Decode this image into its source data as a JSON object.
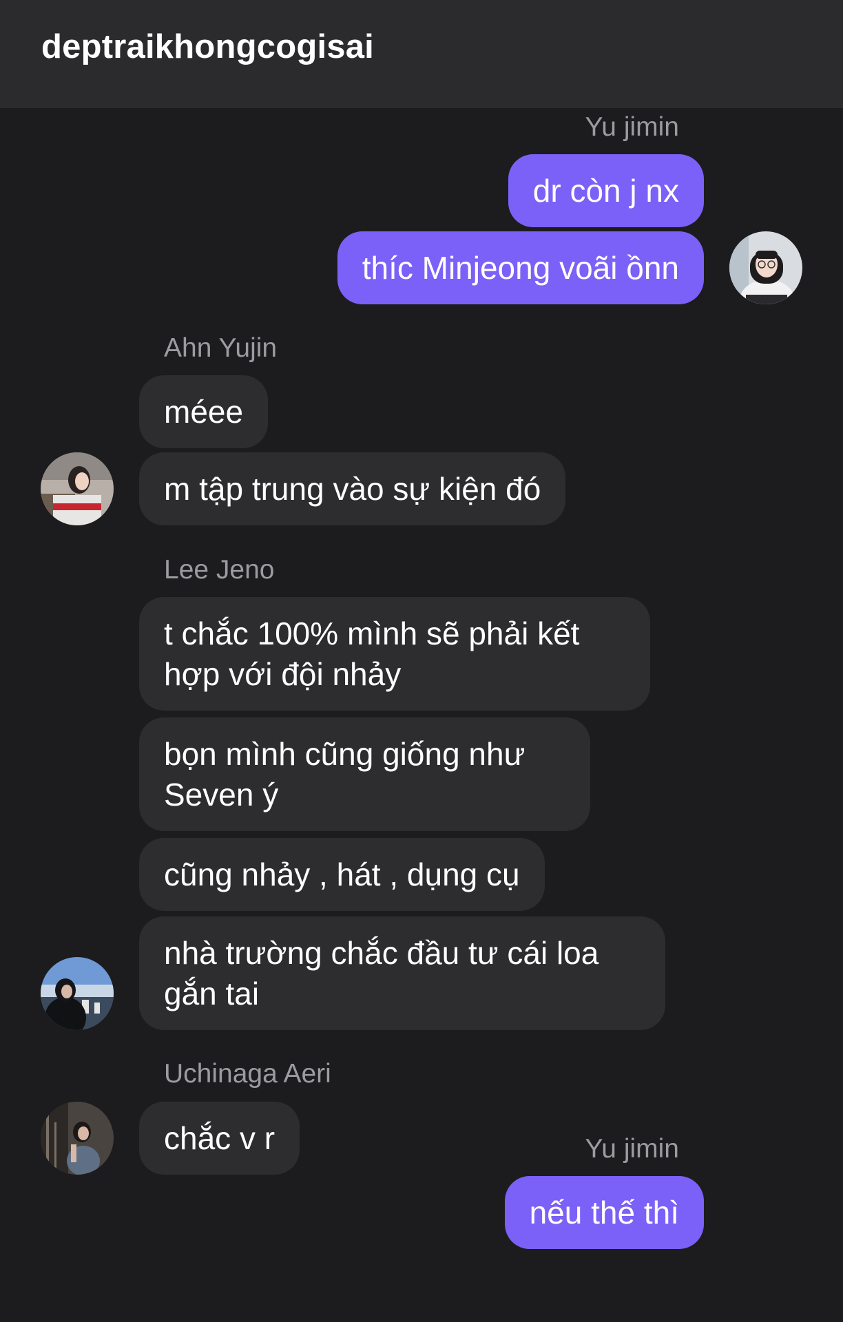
{
  "header": {
    "title": "deptraikhongcogisai"
  },
  "groups": [
    {
      "sender": "Yu jimin",
      "side": "outgoing",
      "messages": [
        "dr còn j nx",
        "thíc Minjeong voãi ồnn"
      ]
    },
    {
      "sender": "Ahn Yujin",
      "side": "incoming",
      "messages": [
        "méee",
        "m tập trung vào sự kiện đó"
      ]
    },
    {
      "sender": "Lee Jeno",
      "side": "incoming",
      "messages": [
        "t chắc 100% mình sẽ phải kết hợp với đội nhảy",
        "bọn mình cũng giống như Seven ý",
        "cũng nhảy , hát , dụng cụ",
        "nhà trường chắc đầu tư cái loa gắn tai"
      ]
    },
    {
      "sender": "Uchinaga Aeri",
      "side": "incoming",
      "messages": [
        "chắc v r"
      ]
    },
    {
      "sender": "Yu jimin",
      "side": "outgoing",
      "messages": [
        "nếu thế thì"
      ]
    }
  ],
  "colors": {
    "background": "#1c1c1e",
    "header": "#2b2b2d",
    "outgoing_bubble": "#7b61f7",
    "incoming_bubble": "#2d2d30",
    "sender_name": "#9b9ba0"
  },
  "avatars": [
    "avatar-yu-jimin",
    "avatar-ahn-yujin",
    "avatar-lee-jeno",
    "avatar-uchinaga-aeri"
  ]
}
